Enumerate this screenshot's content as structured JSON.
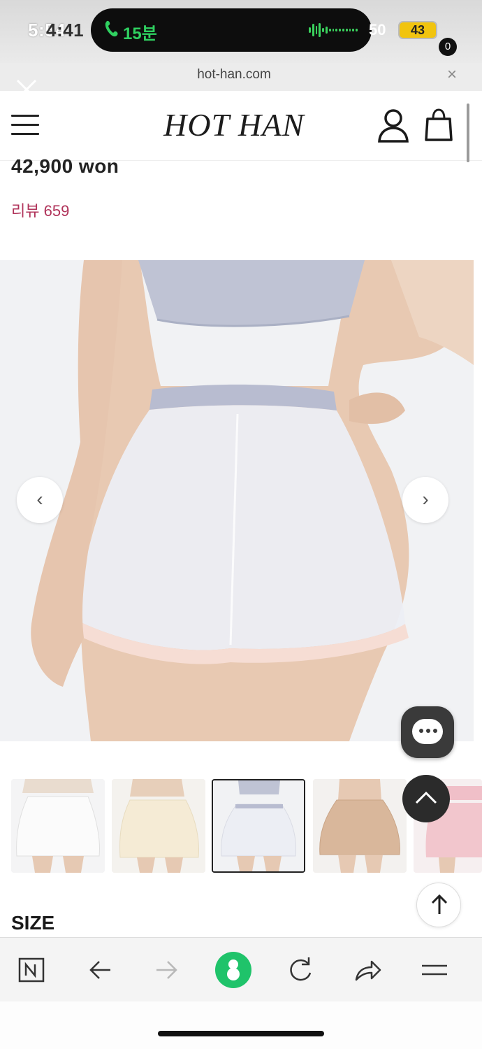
{
  "status_bar": {
    "time": "5:54",
    "time_ghost": "4:41",
    "call_duration": "15분",
    "right_text": "50",
    "battery": "43"
  },
  "browser": {
    "url": "hot-han.com",
    "close_symbol": "×"
  },
  "site": {
    "logo": "HOT HAN",
    "cart_count": "0"
  },
  "product": {
    "price": "42,900 won",
    "review_label": "리뷰 659"
  },
  "gallery": {
    "prev_symbol": "‹",
    "next_symbol": "›",
    "thumbnails": [
      {
        "color": "#f7f7f7",
        "selected": false
      },
      {
        "color": "#f6eedc",
        "selected": false
      },
      {
        "color": "#eceef3",
        "selected": true
      },
      {
        "color": "#d6b498",
        "selected": false
      },
      {
        "color": "#f0bfc8",
        "selected": false
      }
    ]
  },
  "sections": {
    "size_title": "SIZE"
  },
  "toolbar": {
    "items": [
      "naver-icon",
      "back-icon",
      "forward-icon",
      "home-icon",
      "reload-icon",
      "share-icon",
      "menu-icon"
    ]
  },
  "colors": {
    "review": "#b0335a",
    "accent_green": "#1fc36a",
    "dark": "#2b2b2b"
  }
}
